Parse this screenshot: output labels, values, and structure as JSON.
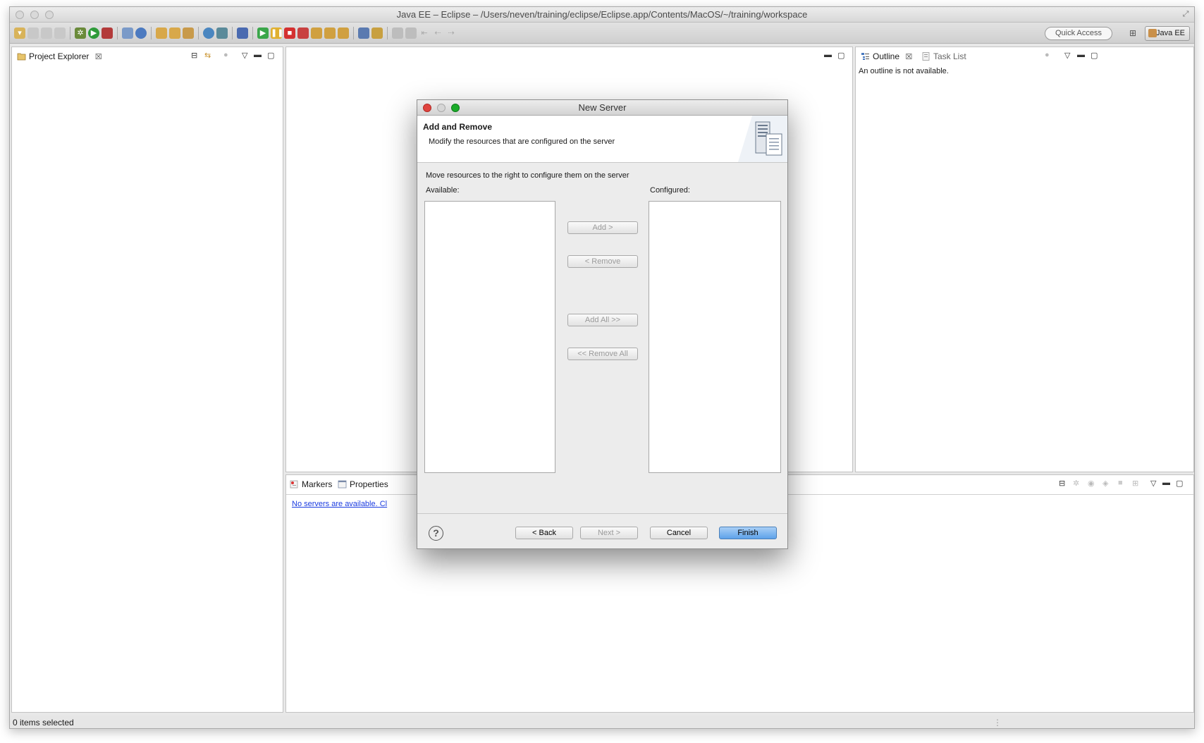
{
  "window": {
    "title": "Java EE – Eclipse – /Users/neven/training/eclipse/Eclipse.app/Contents/MacOS/~/training/workspace"
  },
  "toolbar": {
    "quick_access": "Quick Access",
    "perspective": "Java EE"
  },
  "left_panel": {
    "tab_label": "Project Explorer"
  },
  "right_panel": {
    "tab_outline": "Outline",
    "tab_tasklist": "Task List",
    "message": "An outline is not available."
  },
  "bottom_panel": {
    "tab_markers": "Markers",
    "tab_properties": "Properties",
    "servers_link": "No servers are available. Cl"
  },
  "status_bar": {
    "text": "0 items selected"
  },
  "dialog": {
    "title": "New Server",
    "header_title": "Add and Remove",
    "header_desc": "Modify the resources that are configured on the server",
    "instruction": "Move resources to the right to configure them on the server",
    "available_label": "Available:",
    "configured_label": "Configured:",
    "btn_add": "Add >",
    "btn_remove": "< Remove",
    "btn_add_all": "Add All >>",
    "btn_remove_all": "<< Remove All",
    "btn_back": "< Back",
    "btn_next": "Next >",
    "btn_cancel": "Cancel",
    "btn_finish": "Finish"
  },
  "colors": {
    "finish_button": "#5ea2ea",
    "link": "#1a3be0",
    "close_red": "#e0443e",
    "min_yellow": "#dea123",
    "max_green": "#1aab29"
  }
}
